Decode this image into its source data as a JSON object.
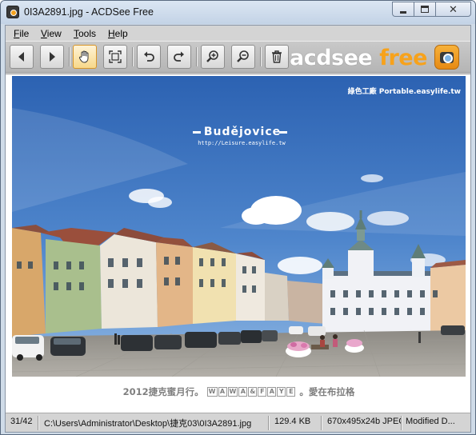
{
  "window": {
    "title": "0I3A2891.jpg - ACDSee Free"
  },
  "menu": {
    "file": "File",
    "view": "View",
    "tools": "Tools",
    "help": "Help"
  },
  "toolbar": {
    "buttons": [
      "arrow-left-icon",
      "arrow-right-icon",
      "hand-pan-icon",
      "fit-screen-icon",
      "rotate-left-icon",
      "rotate-right-icon",
      "zoom-in-icon",
      "zoom-out-icon",
      "trash-icon"
    ],
    "active_tool": "hand-pan-icon"
  },
  "brand": {
    "word1": "acdsee",
    "word2": "free",
    "white": "#ffffff",
    "orange": "#f7a21b"
  },
  "photo": {
    "city_title": "Budějovice",
    "city_url": "http://Leisure.easylife.tw",
    "watermark": "綠色工廠 Portable.easylife.tw",
    "credit_prefix": "2012捷克蜜月行。",
    "credit_letters": [
      "W",
      "A",
      "W",
      "A",
      "&",
      "F",
      "A",
      "Y",
      "E"
    ],
    "credit_suffix": "。愛在布拉格"
  },
  "status": {
    "position": "31/42",
    "path": "C:\\Users\\Administrator\\Desktop\\捷克03\\0I3A2891.jpg",
    "size": "129.4 KB",
    "dimensions": "670x495x24b JPEG",
    "modified": "Modified D..."
  }
}
